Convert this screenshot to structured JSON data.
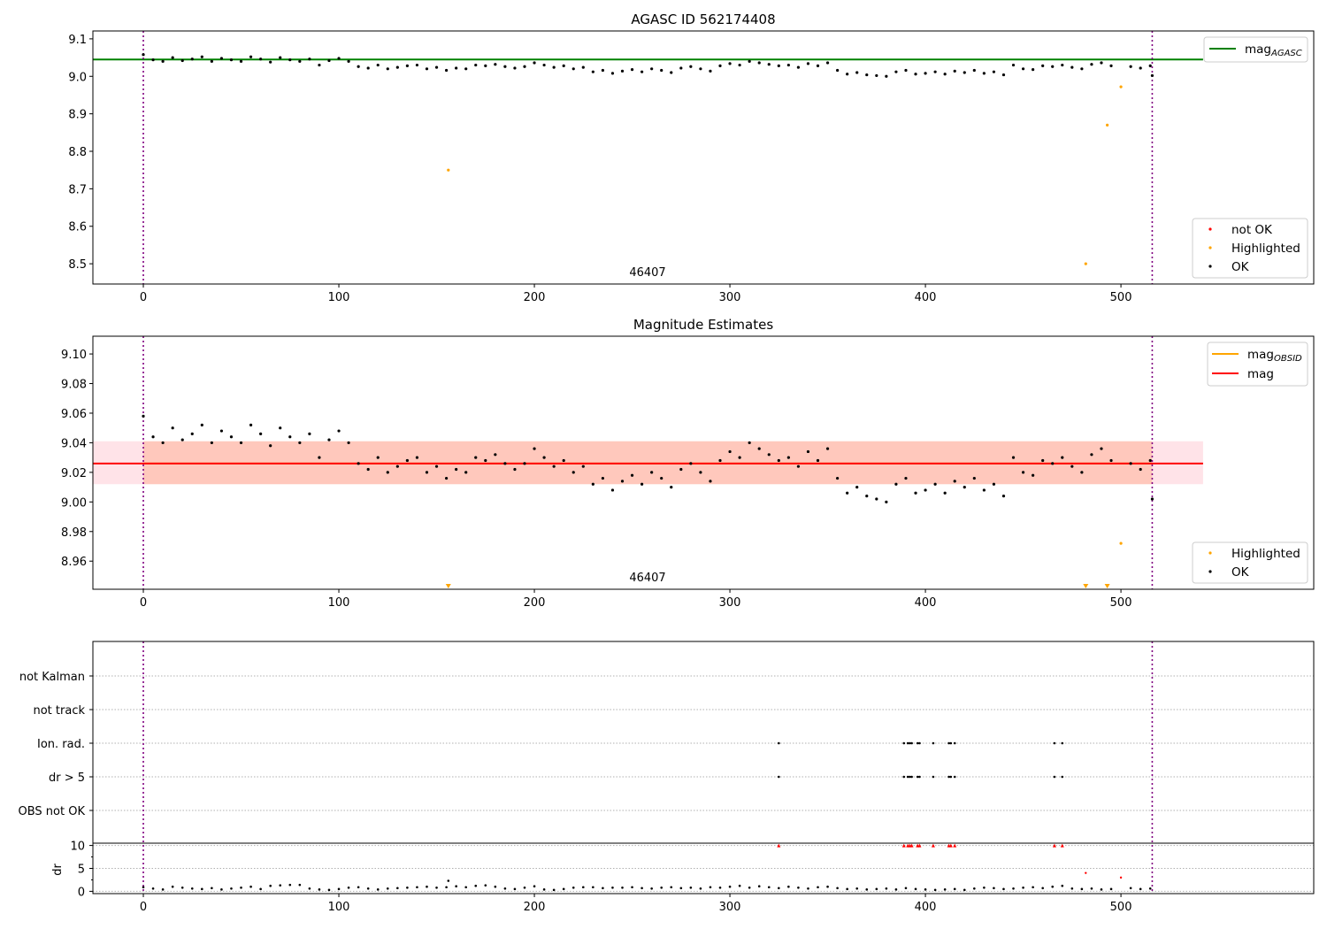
{
  "chart_data": [
    {
      "type": "scatter",
      "title": "AGASC ID 562174408",
      "annotation": "46407",
      "xlim": [
        -25.8,
        598.6
      ],
      "ylim": [
        8.446,
        9.121
      ],
      "xticks": [
        "0",
        "100",
        "200",
        "300",
        "400",
        "500"
      ],
      "yticks": [
        "9.1",
        "9.0",
        "8.9",
        "8.8",
        "8.7",
        "8.6",
        "8.5"
      ],
      "obsid_boundaries": [
        0,
        516
      ],
      "mag_agasc": 9.045,
      "legend_lines": [
        {
          "name": "mag_AGASC",
          "label": "mag",
          "sub": "AGASC",
          "color": "#008000"
        }
      ],
      "legend_points": [
        {
          "name": "not OK",
          "color": "#ff0000"
        },
        {
          "name": "Highlighted",
          "color": "#ffa500"
        },
        {
          "name": "OK",
          "color": "#000000"
        }
      ],
      "legend_placement": [
        "upper right",
        "lower right"
      ]
    },
    {
      "type": "scatter",
      "title": "Magnitude Estimates",
      "annotation": "46407",
      "xlim": [
        -25.8,
        598.6
      ],
      "ylim": [
        8.941,
        9.112
      ],
      "xticks": [
        "0",
        "100",
        "200",
        "300",
        "400",
        "500"
      ],
      "yticks": [
        "9.10",
        "9.08",
        "9.06",
        "9.04",
        "9.02",
        "9.00",
        "8.98",
        "8.96"
      ],
      "mag": 9.026,
      "mag_obsid": 9.026,
      "mag_band": [
        9.012,
        9.041
      ],
      "legend_lines": [
        {
          "name": "mag_OBSID",
          "label": "mag",
          "sub": "OBSID",
          "color": "#ffa500"
        },
        {
          "name": "mag",
          "label": "mag",
          "sub": "",
          "color": "#ff0000"
        }
      ],
      "legend_points": [
        {
          "name": "Highlighted",
          "color": "#ffa500"
        },
        {
          "name": "OK",
          "color": "#000000"
        }
      ],
      "legend_placement": [
        "upper right",
        "lower right"
      ]
    },
    {
      "type": "scatter",
      "flag_labels": [
        "not Kalman",
        "not track",
        "Ion. rad.",
        "dr > 5",
        "OBS not OK"
      ],
      "flags": {
        "Ion. rad.": [
          325,
          389,
          391,
          392,
          393,
          396,
          397,
          404,
          412,
          413,
          415,
          466,
          470
        ],
        "dr > 5": [
          325,
          389,
          391,
          392,
          393,
          396,
          397,
          404,
          412,
          413,
          415,
          466,
          470
        ]
      },
      "ylabel": "dr",
      "dr_ylim": [
        -0.5,
        10.5
      ],
      "dr_yticks": [
        "10",
        "5",
        "0"
      ],
      "dr_clipped_not_ok": [
        325,
        389,
        391,
        392,
        393,
        396,
        397,
        404,
        412,
        413,
        415,
        466,
        470
      ],
      "dr_clipped_value": 10,
      "dr_highlighted": {
        "x": [
          482,
          500
        ],
        "y": [
          4.0,
          3.0
        ]
      },
      "xticks": [
        "0",
        "100",
        "200",
        "300",
        "400",
        "500"
      ]
    }
  ],
  "series": {
    "ok_x_step": 5,
    "ok_mag": [
      9.058,
      9.044,
      9.04,
      9.05,
      9.042,
      9.046,
      9.052,
      9.04,
      9.048,
      9.044,
      9.04,
      9.052,
      9.046,
      9.038,
      9.05,
      9.044,
      9.04,
      9.046,
      9.03,
      9.042,
      9.048,
      9.04,
      9.026,
      9.022,
      9.03,
      9.02,
      9.024,
      9.028,
      9.03,
      9.02,
      9.024,
      9.016,
      9.022,
      9.02,
      9.03,
      9.028,
      9.032,
      9.026,
      9.022,
      9.026,
      9.036,
      9.03,
      9.024,
      9.028,
      9.02,
      9.024,
      9.012,
      9.016,
      9.008,
      9.014,
      9.018,
      9.012,
      9.02,
      9.016,
      9.01,
      9.022,
      9.026,
      9.02,
      9.014,
      9.028,
      9.034,
      9.03,
      9.04,
      9.036,
      9.032,
      9.028,
      9.03,
      9.024,
      9.034,
      9.028,
      9.036,
      9.016,
      9.006,
      9.01,
      9.004,
      9.002,
      9.0,
      9.012,
      9.016,
      9.006,
      9.008,
      9.012,
      9.006,
      9.014,
      9.01,
      9.016,
      9.008,
      9.012,
      9.004,
      9.03,
      9.02,
      9.018,
      9.028,
      9.026,
      9.03,
      9.024,
      9.02,
      9.032,
      9.036,
      9.028,
      9.024,
      9.026,
      9.022,
      9.028
    ],
    "ok_last": {
      "x": 516,
      "mag": 9.002
    },
    "highlighted": {
      "x": [
        156,
        482,
        493,
        500
      ],
      "mag": [
        8.75,
        8.5,
        8.87,
        8.972
      ]
    },
    "ok_dr": [
      0.9,
      0.6,
      0.4,
      1.0,
      0.8,
      0.6,
      0.5,
      0.7,
      0.4,
      0.6,
      0.8,
      1.0,
      0.5,
      1.2,
      1.3,
      1.4,
      1.4,
      0.6,
      0.4,
      0.3,
      0.5,
      0.8,
      0.9,
      0.6,
      0.4,
      0.6,
      0.7,
      0.8,
      0.9,
      1.0,
      0.8,
      0.9,
      1.1,
      0.9,
      1.2,
      1.3,
      1.0,
      0.6,
      0.5,
      0.8,
      1.1,
      0.4,
      0.3,
      0.5,
      0.8,
      0.9,
      0.9,
      0.7,
      0.8,
      0.8,
      0.9,
      0.7,
      0.6,
      0.8,
      0.9,
      0.7,
      0.8,
      0.6,
      0.9,
      0.8,
      1.0,
      1.2,
      0.8,
      1.1,
      0.9,
      0.7,
      1.0,
      0.8,
      0.6,
      0.9,
      1.0,
      0.7,
      0.5,
      0.6,
      0.4,
      0.5,
      0.6,
      0.4,
      0.7,
      0.5,
      0.4,
      0.3,
      0.4,
      0.5,
      0.3,
      0.6,
      0.8,
      0.7,
      0.5,
      0.6,
      0.8,
      0.9,
      0.7,
      1.0,
      1.2,
      0.6,
      0.5,
      0.6,
      0.4,
      0.5,
      0.6,
      0.7,
      0.5,
      0.6
    ],
    "dr_extra": {
      "x": [
        156
      ],
      "dr": [
        2.3
      ]
    }
  },
  "colors": {
    "ok": "#000000",
    "highlighted": "#ffa500",
    "not_ok": "#ff0000",
    "agasc": "#008000",
    "boundary": "#800080",
    "band": "#ffc0cb",
    "band_obsid": "#ffa07a"
  }
}
